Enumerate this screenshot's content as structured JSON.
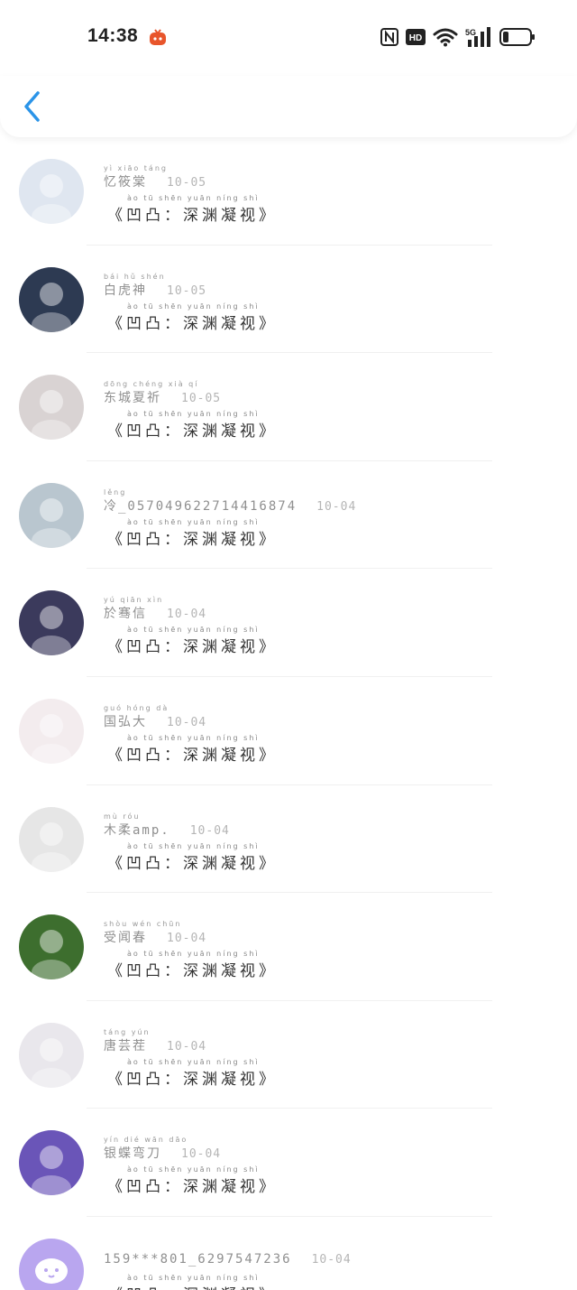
{
  "status": {
    "time": "14:38",
    "network": "5G"
  },
  "header": {
    "back_icon": "chevron-left-icon"
  },
  "message_pinyin": "ào tū     shēn yuān níng shì",
  "messages": [
    {
      "name_pinyin": "yì xiāo táng",
      "name": "忆筱棠",
      "date": "10-05",
      "text": "《凹凸：深渊凝视》",
      "avatar_color": "#dfe6f0"
    },
    {
      "name_pinyin": "bái hǔ shén",
      "name": "白虎神",
      "date": "10-05",
      "text": "《凹凸：深渊凝视》",
      "avatar_color": "#2d3a52"
    },
    {
      "name_pinyin": "dōng chéng xià qí",
      "name": "东城夏祈",
      "date": "10-05",
      "text": "《凹凸：深渊凝视》",
      "avatar_color": "#d9d3d3"
    },
    {
      "name_pinyin": "lěng",
      "name": "冷_057049622714416874",
      "date": "10-04",
      "text": "《凹凸：深渊凝视》",
      "avatar_color": "#b9c6cf"
    },
    {
      "name_pinyin": "yú qiān xìn",
      "name": "於骞信",
      "date": "10-04",
      "text": "《凹凸：深渊凝视》",
      "avatar_color": "#3b3a5c"
    },
    {
      "name_pinyin": "guó hóng dà",
      "name": "国弘大",
      "date": "10-04",
      "text": "《凹凸：深渊凝视》",
      "avatar_color": "#f3ecee"
    },
    {
      "name_pinyin": "mù róu",
      "name": "木柔amp.",
      "date": "10-04",
      "text": "《凹凸：深渊凝视》",
      "avatar_color": "#e6e6e6"
    },
    {
      "name_pinyin": "shòu wén chūn",
      "name": "受闻春",
      "date": "10-04",
      "text": "《凹凸：深渊凝视》",
      "avatar_color": "#3d6e2e"
    },
    {
      "name_pinyin": "táng yún",
      "name": "唐芸茬",
      "date": "10-04",
      "text": "《凹凸：深渊凝视》",
      "avatar_color": "#e9e7ec"
    },
    {
      "name_pinyin": "yín dié wān dāo",
      "name": "银蝶弯刀",
      "date": "10-04",
      "text": "《凹凸：深渊凝视》",
      "avatar_color": "#6a55b8"
    },
    {
      "name_pinyin": "",
      "name": "159***801_6297547236",
      "date": "10-04",
      "text": "《凹凸：深渊凝视》",
      "avatar_color": "#b9a6ef"
    }
  ]
}
